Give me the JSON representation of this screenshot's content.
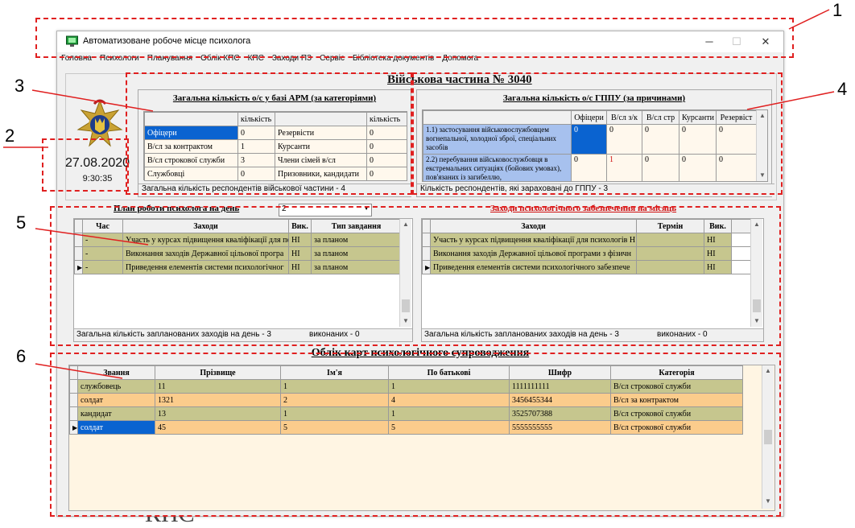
{
  "window": {
    "title": "Автоматизоване робоче місце психолога",
    "minimize": "─",
    "maximize": "☐",
    "close": "✕"
  },
  "menu": [
    "Головна",
    "Психологи",
    "Планування",
    "Облік КПС",
    "КПС",
    "Заходи ПЗ",
    "Сервіс",
    "Бібліотека документів",
    "Допомога"
  ],
  "unit_title": "Військова частина № 3040",
  "date": "27.08.2020",
  "time": "9:30:35",
  "categories_panel": {
    "title": "Загальна кількість о/с у базі АРМ (за категоріями)",
    "header_count": "кількість",
    "rows": [
      {
        "label": "Офіцери",
        "count": "0",
        "label2": "Резервісти",
        "count2": "0"
      },
      {
        "label": "В/сл за контрактом",
        "count": "1",
        "label2": "Курсанти",
        "count2": "0"
      },
      {
        "label": "В/сл строкової служби",
        "count": "3",
        "label2": "Члени сімей в/сл",
        "count2": "0"
      },
      {
        "label": "Службовці",
        "count": "0",
        "label2": "Призовники, кандидати",
        "count2": "0"
      }
    ],
    "footer": "Загальна кількість респондентів військової частини - 4"
  },
  "gppu_panel": {
    "title": "Загальна кількість о/с ГППУ (за причинами)",
    "headers": [
      "Офіцери",
      "В/сл з/к",
      "В/сл стр",
      "Курсанти",
      "Резервіст"
    ],
    "rows": [
      {
        "reason": "1.1) застосування військовослужбовцем вогнепальної, холодної зброї, спеціальних засобів",
        "values": [
          "0",
          "0",
          "0",
          "0",
          "0"
        ]
      },
      {
        "reason": "2.2) перебування військовослужбовця в екстремальних ситуаціях (бойових умовах), пов'язаних із загибеллю,",
        "values": [
          "0",
          "1",
          "0",
          "0",
          "0"
        ]
      }
    ],
    "footer": "Кількість респондентів, які зараховані до ГППУ - 3"
  },
  "plan_panel": {
    "title": "План роботи психолога на день",
    "day_value": "2",
    "headers": [
      "Час",
      "Заходи",
      "Вик.",
      "Тип завдання"
    ],
    "rows": [
      {
        "time": "-",
        "event": "Участь у курсах підвищення кваліфікації для пс",
        "done": "НІ",
        "type": "за планом"
      },
      {
        "time": "-",
        "event": "Виконання заходів Державної цільової програ",
        "done": "НІ",
        "type": "за планом"
      },
      {
        "time": "-",
        "event": "Приведення елементів системи психологічног",
        "done": "НІ",
        "type": "за планом"
      }
    ],
    "footer_planned": "Загальна кількість запланованих заходів на день - 3",
    "footer_done": "виконаних - 0"
  },
  "month_panel": {
    "title": "Заходи психологічного забезпечення на місяць",
    "headers": [
      "Заходи",
      "Термін",
      "Вик."
    ],
    "rows": [
      {
        "event": "Участь у курсах підвищення кваліфікації для психологів Н",
        "term": "",
        "done": "НІ"
      },
      {
        "event": "Виконання заходів Державної цільової програми з фізичн",
        "term": "",
        "done": "НІ"
      },
      {
        "event": "Приведення елементів системи психологічного забезпече",
        "term": "",
        "done": "НІ"
      }
    ],
    "footer_planned": "Загальна кількість запланованих заходів на день - 3",
    "footer_done": "виконаних - 0"
  },
  "cards_panel": {
    "title": "Облік карт психологічного супроводження",
    "headers": [
      "Звання",
      "Прізвище",
      "Ім'я",
      "По батькові",
      "Шифр",
      "Категорія"
    ],
    "rows": [
      {
        "rank": "службовець",
        "surname": "11",
        "name": "1",
        "patronymic": "1",
        "code": "1111111111",
        "category": "В/сл строкової служби"
      },
      {
        "rank": "солдат",
        "surname": "1321",
        "name": "2",
        "patronymic": "4",
        "code": "3456455344",
        "category": "В/сл за контрактом"
      },
      {
        "rank": "кандидат",
        "surname": "13",
        "name": "1",
        "patronymic": "1",
        "code": "3525707388",
        "category": "В/сл строкової служби"
      },
      {
        "rank": "солдат",
        "surname": "45",
        "name": "5",
        "patronymic": "5",
        "code": "5555555555",
        "category": "В/сл строкової служби"
      }
    ]
  },
  "callouts": [
    "1",
    "2",
    "3",
    "4",
    "5",
    "6"
  ],
  "background_text": "КПС",
  "colors": {
    "annotation": "#e02020",
    "row_olive": "#c6c68e",
    "row_peach": "#fbcc8c",
    "row_blue": "#a7c1ee",
    "selected": "#0a63d0"
  }
}
